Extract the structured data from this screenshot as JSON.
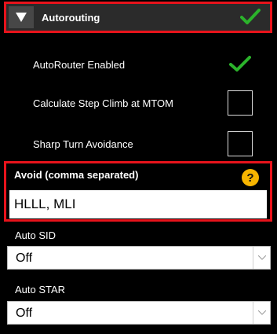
{
  "header": {
    "title": "Autorouting"
  },
  "options": [
    {
      "label": "AutoRouter Enabled",
      "checked": true
    },
    {
      "label": "Calculate Step Climb at MTOM",
      "checked": false
    },
    {
      "label": "Sharp Turn Avoidance",
      "checked": false
    }
  ],
  "avoid": {
    "label": "Avoid (comma separated)",
    "help": "?",
    "value": "HLLL, MLI"
  },
  "auto_sid": {
    "label": "Auto SID",
    "value": "Off"
  },
  "auto_star": {
    "label": "Auto STAR",
    "value": "Off"
  },
  "colors": {
    "highlight": "#e8131b",
    "check": "#2bb32b",
    "help": "#f7b500"
  }
}
